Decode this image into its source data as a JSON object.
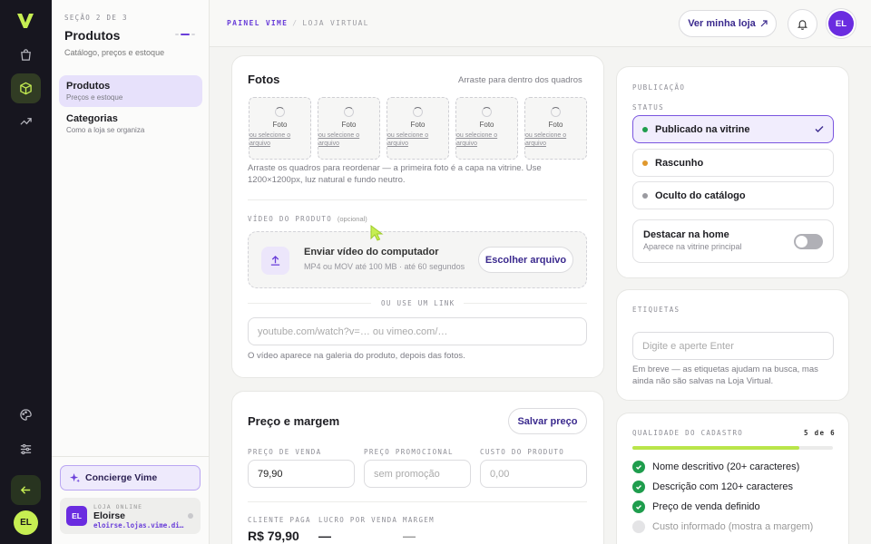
{
  "rail": {
    "items": [
      "bag-icon",
      "box-icon",
      "trend-icon"
    ],
    "bottom": [
      "palette-icon",
      "sliders-icon",
      "back-arrow-icon"
    ],
    "avatar": "EL"
  },
  "sidebar": {
    "section": "SEÇÃO 2 DE 3",
    "title": "Produtos",
    "subtitle": "Catálogo, preços e estoque",
    "items": [
      {
        "label": "Produtos",
        "desc": "Preços e estoque",
        "active": true
      },
      {
        "label": "Categorias",
        "desc": "Como a loja se organiza",
        "active": false
      }
    ],
    "concierge": "Concierge Vime",
    "store": {
      "kicker": "LOJA ONLINE",
      "name": "Eloirse",
      "url": "eloirse.lojas.vime.di…",
      "avatar": "EL"
    }
  },
  "topbar": {
    "crumb_a": "PAINEL VIME",
    "crumb_sep": "/",
    "crumb_b": "LOJA VIRTUAL",
    "visit": "Ver minha loja",
    "avatar": "EL"
  },
  "photos": {
    "title": "Fotos",
    "hint": "Arraste para dentro dos quadros",
    "slot_label": "Foto",
    "slot_picker": "ou selecione o arquivo",
    "note": "Arraste os quadros para reordenar — a primeira foto é a capa na vitrine. Use 1200×1200px, luz natural e fundo neutro.",
    "video_label": "VÍDEO DO PRODUTO",
    "video_optional": "(opcional)",
    "upload_title": "Enviar vídeo do computador",
    "upload_sub": "MP4 ou MOV até 100 MB · até 60 segundos",
    "upload_button": "Escolher arquivo",
    "or_link": "OU USE UM LINK",
    "link_placeholder": "youtube.com/watch?v=… ou vimeo.com/…",
    "link_note": "O vídeo aparece na galeria do produto, depois das fotos."
  },
  "pricing": {
    "title": "Preço e margem",
    "save": "Salvar preço",
    "sale_label": "PREÇO DE VENDA",
    "sale_value": "79,90",
    "promo_label": "PREÇO PROMOCIONAL",
    "promo_placeholder": "sem promoção",
    "cost_label": "CUSTO DO PRODUTO",
    "cost_placeholder": "0,00",
    "client_label": "CLIENTE PAGA",
    "client_value": "R$ 79,90",
    "profit_label": "LUCRO POR VENDA",
    "profit_value": "—",
    "margin_label": "MARGEM",
    "margin_value": "—"
  },
  "publication": {
    "section": "PUBLICAÇÃO",
    "status_label": "STATUS",
    "options": [
      {
        "label": "Publicado na vitrine",
        "color": "#1f9d4d",
        "selected": true
      },
      {
        "label": "Rascunho",
        "color": "#e0982d",
        "selected": false
      },
      {
        "label": "Oculto do catálogo",
        "color": "#9a9aa0",
        "selected": false
      }
    ],
    "highlight_title": "Destacar na home",
    "highlight_sub": "Aparece na vitrine principal",
    "highlight_on": false
  },
  "tags": {
    "section": "ETIQUETAS",
    "placeholder": "Digite e aperte Enter",
    "note": "Em breve — as etiquetas ajudam na busca, mas ainda não são salvas na Loja Virtual."
  },
  "quality": {
    "section": "QUALIDADE DO CADASTRO",
    "score": "5 de 6",
    "progress": 0.833,
    "items": [
      {
        "label": "Nome descritivo (20+ caracteres)",
        "done": true
      },
      {
        "label": "Descrição com 120+ caracteres",
        "done": true
      },
      {
        "label": "Preço de venda definido",
        "done": true
      },
      {
        "label": "Custo informado (mostra a margem)",
        "done": false
      }
    ]
  },
  "colors": {
    "accent": "#6a3fd9",
    "lime": "#c6ee52",
    "rail": "#17161f"
  }
}
